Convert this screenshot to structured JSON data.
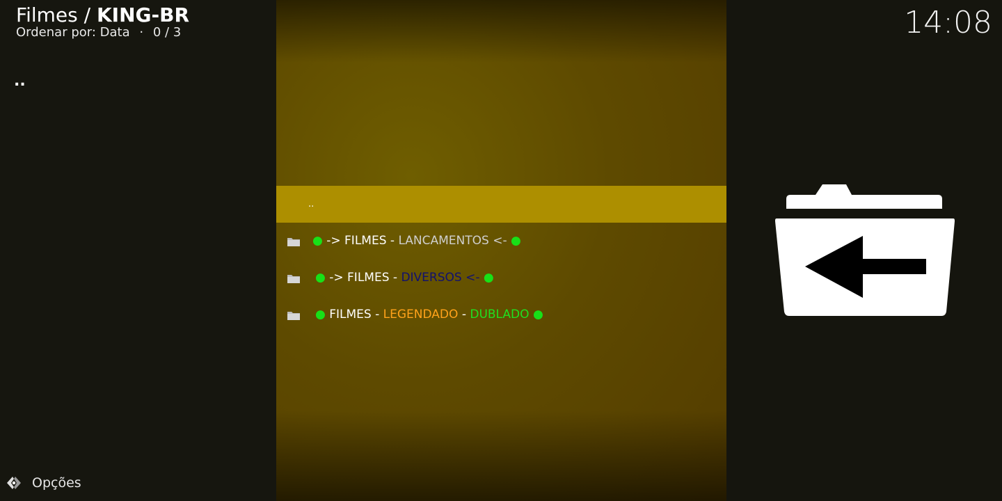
{
  "header": {
    "path": "Filmes",
    "separator": "/",
    "current": "KING-BR",
    "sort_label": "Ordenar por: Data",
    "dot": "·",
    "count": "0 / 3"
  },
  "clock": "14:08",
  "left_panel": {
    "parent_item": ".."
  },
  "list": {
    "parent": "..",
    "items": [
      {
        "parts": [
          "●",
          " -> FILMES - ",
          "LANCAMENTOS <-",
          " ●"
        ]
      },
      {
        "parts": [
          "●",
          " -> FILMES - ",
          "DIVERSOS <-",
          " ●"
        ]
      },
      {
        "parts": [
          "●",
          " FILMES - ",
          "LEGENDADO",
          " - ",
          "DUBLADO",
          " ●"
        ]
      }
    ]
  },
  "footer": {
    "options_label": "Opções"
  },
  "icons": {
    "folder": "folder-icon",
    "back": "folder-back-icon",
    "options": "options-icon"
  },
  "colors": {
    "selected_row": "#ad8f00",
    "bullet_green": "#18e018",
    "legendado_orange": "#ffa21a",
    "dublado_green": "#20e020",
    "diversos_navy": "#101070"
  }
}
